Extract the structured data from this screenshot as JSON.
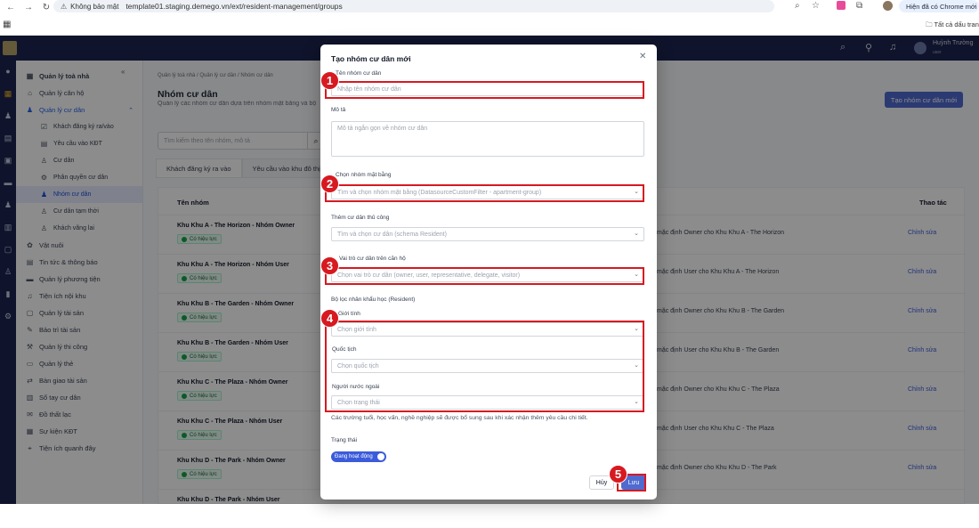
{
  "browser": {
    "security_label": "Không bảo mật",
    "url": "template01.staging.demego.vn/ext/resident-management/groups",
    "chrome_badge": "Hiện đã có Chrome mới",
    "bookmarks_label": "Tất cả dấu trang"
  },
  "topbar": {
    "user_name": "Huỳnh Trường",
    "user_role": "user"
  },
  "sidebar": {
    "items": [
      {
        "label": "Quản lý toà nhà",
        "icon": "building-icon"
      },
      {
        "label": "Quản lý căn hộ",
        "icon": "home-icon"
      },
      {
        "label": "Quản lý cư dân",
        "icon": "people-icon"
      },
      {
        "label": "Khách đăng ký ra/vào",
        "icon": "checklist-icon"
      },
      {
        "label": "Yêu cầu vào KĐT",
        "icon": "document-icon"
      },
      {
        "label": "Cư dân",
        "icon": "user-icon"
      },
      {
        "label": "Phân quyền cư dân",
        "icon": "gear-icon"
      },
      {
        "label": "Nhóm cư dân",
        "icon": "group-icon"
      },
      {
        "label": "Cư dân tạm thời",
        "icon": "user-icon"
      },
      {
        "label": "Khách vãng lai",
        "icon": "user-icon"
      },
      {
        "label": "Vật nuôi",
        "icon": "paw-icon"
      },
      {
        "label": "Tin tức & thông báo",
        "icon": "news-icon"
      },
      {
        "label": "Quản lý phương tiện",
        "icon": "car-icon"
      },
      {
        "label": "Tiện ích nội khu",
        "icon": "bell-icon"
      },
      {
        "label": "Quản lý tài sản",
        "icon": "box-icon"
      },
      {
        "label": "Bảo trì tài sản",
        "icon": "wrench-icon"
      },
      {
        "label": "Quản lý thi công",
        "icon": "tool-icon"
      },
      {
        "label": "Quản lý thẻ",
        "icon": "card-icon"
      },
      {
        "label": "Bàn giao tài sản",
        "icon": "handover-icon"
      },
      {
        "label": "Sổ tay cư dân",
        "icon": "book-icon"
      },
      {
        "label": "Đồ thất lạc",
        "icon": "lost-icon"
      },
      {
        "label": "Sự kiện KĐT",
        "icon": "calendar-icon"
      },
      {
        "label": "Tiện ích quanh đây",
        "icon": "map-icon"
      }
    ]
  },
  "main": {
    "breadcrumb": "Quản lý toà nhà  /  Quản lý cư dân  /  Nhóm cư dân",
    "title": "Nhóm cư dân",
    "subtitle": "Quản lý các nhóm cư dân dựa trên nhóm mặt bằng và bộ",
    "create_button": "Tạo nhóm cư dân mới",
    "search_placeholder": "Tìm kiếm theo tên nhóm, mô tả",
    "tabs": [
      "Khách đăng ký ra vào",
      "Yêu cầu vào khu đô thị"
    ],
    "columns": {
      "name": "Tên nhóm",
      "actions": "Thao tác"
    },
    "rows": [
      {
        "name": "Khu Khu A - The Horizon - Nhóm Owner",
        "status": "Có hiệu lực",
        "desc": "mặc định Owner cho Khu Khu A - The Horizon",
        "action": "Chỉnh sửa"
      },
      {
        "name": "Khu Khu A - The Horizon - Nhóm User",
        "status": "Có hiệu lực",
        "desc": "mặc định User cho Khu Khu A - The Horizon",
        "action": "Chỉnh sửa"
      },
      {
        "name": "Khu Khu B - The Garden - Nhóm Owner",
        "status": "Có hiệu lực",
        "desc": "mặc định Owner cho Khu Khu B - The Garden",
        "action": "Chỉnh sửa"
      },
      {
        "name": "Khu Khu B - The Garden - Nhóm User",
        "status": "Có hiệu lực",
        "desc": "mặc định User cho Khu Khu B - The Garden",
        "action": "Chỉnh sửa"
      },
      {
        "name": "Khu Khu C - The Plaza - Nhóm Owner",
        "status": "Có hiệu lực",
        "desc": "mặc định Owner cho Khu Khu C - The Plaza",
        "action": "Chỉnh sửa"
      },
      {
        "name": "Khu Khu C - The Plaza - Nhóm User",
        "status": "Có hiệu lực",
        "desc": "mặc định User cho Khu Khu C - The Plaza",
        "action": "Chỉnh sửa"
      },
      {
        "name": "Khu Khu D - The Park - Nhóm Owner",
        "status": "Có hiệu lực",
        "desc": "mặc định Owner cho Khu Khu D - The Park",
        "action": "Chỉnh sửa"
      },
      {
        "name": "Khu Khu D - The Park - Nhóm User",
        "status": "",
        "desc": "",
        "action": ""
      }
    ]
  },
  "modal": {
    "title": "Tạo nhóm cư dân mới",
    "group_name_label": "Tên nhóm cư dân",
    "group_name_placeholder": "Nhập tên nhóm cư dân",
    "desc_label": "Mô tả",
    "desc_placeholder": "Mô tả ngắn gọn về nhóm cư dân",
    "floor_group_label": "Chọn nhóm mặt bằng",
    "floor_group_placeholder": "Tìm và chọn nhóm mặt bằng (DatasourceCustomFilter - apartment-group)",
    "manual_label": "Thêm cư dân thủ công",
    "manual_placeholder": "Tìm và chọn cư dân (schema Resident)",
    "role_label": "Vai trò cư dân trên căn hộ",
    "role_placeholder": "Chọn vai trò cư dân (owner, user, representative, delegate, visitor)",
    "demographic_label": "Bộ lọc nhân khẩu học (Resident)",
    "gender_label": "Giới tính",
    "gender_placeholder": "Chọn giới tính",
    "nationality_label": "Quốc tịch",
    "nationality_placeholder": "Chọn quốc tịch",
    "foreigner_label": "Người nước ngoài",
    "foreigner_placeholder": "Chọn trạng thái",
    "note": "Các trường tuổi, học vấn, nghề nghiệp sẽ được bổ sung sau khi xác nhận thêm yêu cầu chi tiết.",
    "status_label": "Trạng thái",
    "status_toggle": "Đang hoạt động",
    "cancel": "Hủy",
    "save": "Lưu"
  },
  "annotations": [
    "1",
    "2",
    "3",
    "4",
    "5"
  ]
}
